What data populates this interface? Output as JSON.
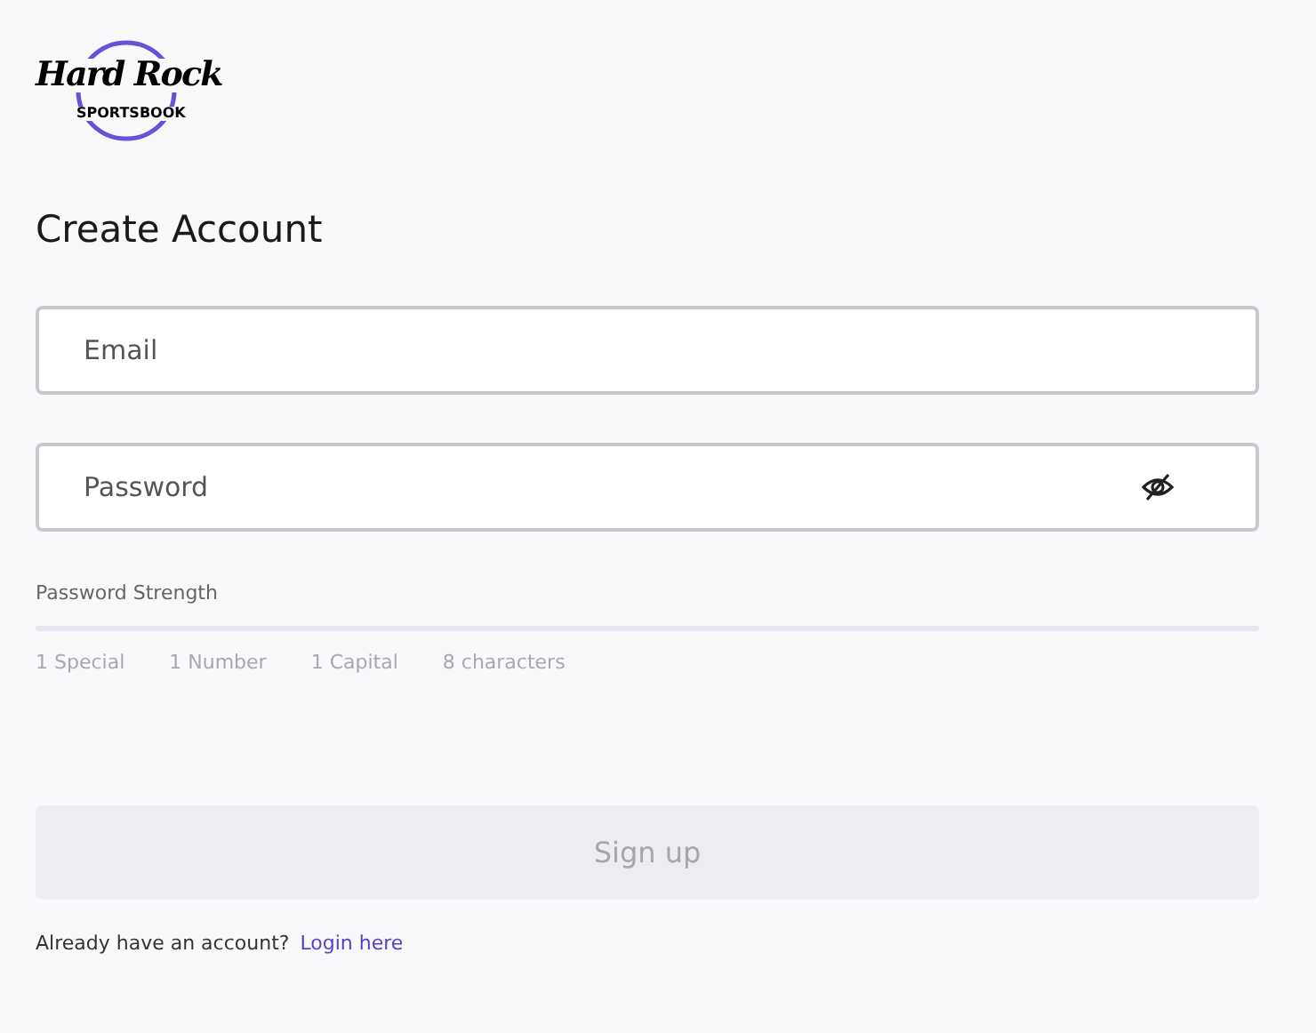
{
  "logo": {
    "name": "Hard Rock",
    "tagline": "SPORTSBOOK"
  },
  "title": "Create Account",
  "fields": [
    {
      "placeholder": "Email"
    },
    {
      "placeholder": "Password",
      "reveal_icon": true
    }
  ],
  "strength": {
    "label": "Password Strength",
    "level": 0,
    "requirements": [
      {
        "label": "1 Special",
        "met": false
      },
      {
        "label": "1 Number",
        "met": false
      },
      {
        "label": "1 Capital",
        "met": false
      },
      {
        "label": "8 characters",
        "met": false
      }
    ]
  },
  "submit": {
    "label": "Sign up",
    "disabled": true
  },
  "footer": {
    "text": "Already have an account?",
    "link": "Login here"
  }
}
